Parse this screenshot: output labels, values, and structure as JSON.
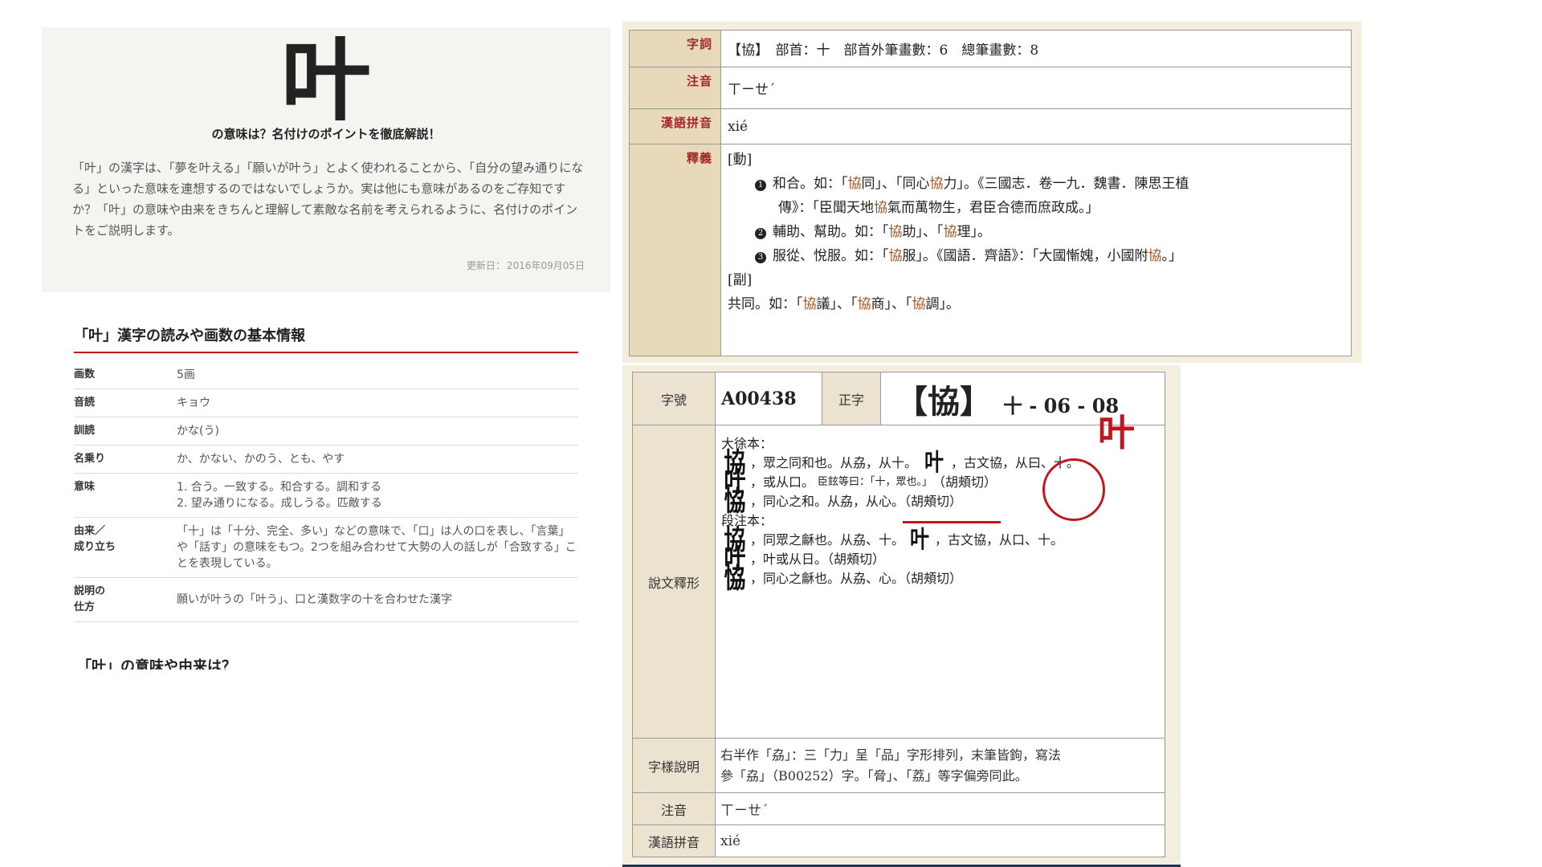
{
  "jp": {
    "kanji": "叶",
    "subtitle": "の意味は？名付けのポイントを徹底解説！",
    "intro": "「叶」の漢字は、「夢を叶える」「願いが叶う」とよく使われることから、「自分の望み通りになる」といった意味を連想するのではないでしょうか。実は他にも意味があるのをご存知ですか？「叶」の意味や由来をきちんと理解して素敵な名前を考えられるように、名付けのポイントをご説明します。",
    "date_label": "更新日：",
    "date": "2016年09月05日",
    "info_title": "「叶」漢字の読みや画数の基本情報",
    "rows": [
      {
        "k": "画数",
        "v": "5画"
      },
      {
        "k": "音読",
        "v": "キョウ"
      },
      {
        "k": "訓読",
        "v": "かな(う)"
      },
      {
        "k": "名乗り",
        "v": "か、かない、かのう、とも、やす"
      },
      {
        "k": "意味",
        "v1": "1. 合う。一致する。和合する。調和する",
        "v2": "2. 望み通りになる。成しうる。匹敵する"
      },
      {
        "k1": "由来／",
        "k2": "成り立ち",
        "v": "「十」は「十分、完全、多い」などの意味で、「口」は人の口を表し、「言葉」や「話す」の意味をもつ。2つを組み合わせて大勢の人の話しが「合致する」ことを表現している。"
      },
      {
        "k1": "説明の",
        "k2": "仕方",
        "v": "願いが叶うの「叶う」、口と漢数字の十を合わせた漢字"
      }
    ],
    "next_title": "「叶」の意味や由来は？"
  },
  "dict1": {
    "labels": {
      "ziti": "字詞",
      "zhuyin": "注音",
      "pinyin": "漢語拼音",
      "shiyi": "釋義"
    },
    "entry": "【協】　部首：十　部首外筆畫數：6　總筆畫數：8",
    "zhuyin": "ㄒㄧㄝˊ",
    "pinyin": "xié",
    "pos_verb": "[動]",
    "s1_num": "1",
    "s1_a": "和合。如：「",
    "s1_hl1": "協",
    "s1_b": "同」、「同心",
    "s1_hl2": "協",
    "s1_c": "力」。《三國志．卷一九．魏書．陳思王植",
    "s1_d": "傳》：「臣聞天地",
    "s1_hl3": "協",
    "s1_e": "氣而萬物生，君臣合德而庶政成。」",
    "s2_num": "2",
    "s2_a": "輔助、幫助。如：「",
    "s2_hl1": "協",
    "s2_b": "助」、「",
    "s2_hl2": "協",
    "s2_c": "理」。",
    "s3_num": "3",
    "s3_a": "服從、悅服。如：「",
    "s3_hl1": "協",
    "s3_b": "服」。《國語．齊語》：「大國慚媿，小國附",
    "s3_hl2": "協",
    "s3_c": "。」",
    "pos_adv": "[副]",
    "adv_a": "共同。如：「",
    "adv_hl1": "協",
    "adv_b": "議」、「",
    "adv_hl2": "協",
    "adv_c": "商」、「",
    "adv_hl3": "協",
    "adv_d": "調」。"
  },
  "dict2": {
    "label_zihao": "字號",
    "code": "A00438",
    "label_zhengzi": "正字",
    "char": "【協】",
    "radical_code": "十 - 06 - 08",
    "label_shuowen": "說文釋形",
    "dxb": "大徐本：",
    "seal1": "協",
    "l1": "，眾之同和也。从劦，从十。",
    "seal_circled": "叶",
    "l1b": "，古文協，从曰、十。",
    "annot": "叶",
    "seal2": "叶",
    "l2a": "，或从口。",
    "l2_small": "臣鉉等曰：「十，眾也。」",
    "l2b": "（胡頰切）",
    "seal3": "恊",
    "l3": "，同心之和。从劦，从心。（胡頰切）",
    "dzb": "段注本：",
    "seal4": "協",
    "l4": "，同眾之龢也。从劦、十。",
    "seal4b": "叶",
    "l4b": "，古文協，从口、十。",
    "seal5": "叶",
    "l5": "，叶或从日。（胡頰切）",
    "seal6": "恊",
    "l6": "，同心之龢也。从劦、心。（胡頰切）",
    "label_ziyang": "字樣說明",
    "ziyang1": "右半作「劦」：三「力」呈「品」字形排列，末筆皆鉤，寫法",
    "ziyang2": "參「劦」（B00252）字。「脅」、「荔」等字偏旁同此。",
    "label_zhuyin": "注音",
    "zhuyin": "ㄒㄧㄝˊ",
    "label_pinyin": "漢語拼音",
    "pinyin": "xié"
  }
}
